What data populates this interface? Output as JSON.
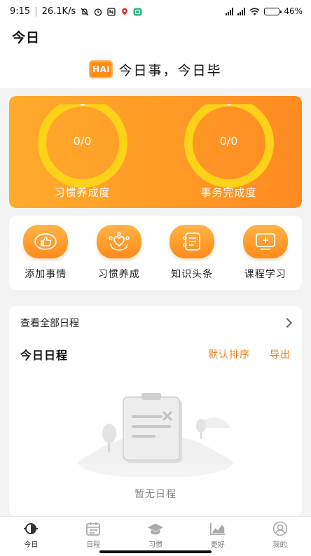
{
  "status_bar": {
    "time": "9:15",
    "speed": "26.1K/s",
    "battery": "46%",
    "battery_fraction": 0.46,
    "icons": [
      "mute-bell-icon",
      "alarm-icon",
      "nfc-icon",
      "map-pin-icon",
      "app-notification-icon",
      "signal-icon",
      "wifi-icon",
      "battery-icon"
    ]
  },
  "header": {
    "title": "今日"
  },
  "slogan": {
    "logo_text": "HAi",
    "text": "今日事，今日毕"
  },
  "progress": {
    "items": [
      {
        "value": "0/0",
        "label": "习惯养成度"
      },
      {
        "value": "0/0",
        "label": "事务完成度"
      }
    ]
  },
  "actions": [
    {
      "label": "添加事情",
      "icon": "thumbs-up-icon"
    },
    {
      "label": "习惯养成",
      "icon": "heart-hands-icon"
    },
    {
      "label": "知识头条",
      "icon": "news-list-icon"
    },
    {
      "label": "课程学习",
      "icon": "course-screen-icon"
    }
  ],
  "schedule": {
    "view_all": "查看全部日程",
    "today_title": "今日日程",
    "sort_label": "默认排序",
    "export_label": "导出",
    "empty_text": "暂无日程"
  },
  "bottom_nav": [
    {
      "label": "今日",
      "icon": "today-icon",
      "active": true
    },
    {
      "label": "日程",
      "icon": "calendar-icon",
      "active": false
    },
    {
      "label": "习惯",
      "icon": "graduation-cap-icon",
      "active": false
    },
    {
      "label": "更好",
      "icon": "trend-chart-icon",
      "active": false
    },
    {
      "label": "我的",
      "icon": "profile-icon",
      "active": false
    }
  ],
  "colors": {
    "accent": "#ff8c1a",
    "ring": "#ffd21a",
    "link": "#f07d1d"
  }
}
